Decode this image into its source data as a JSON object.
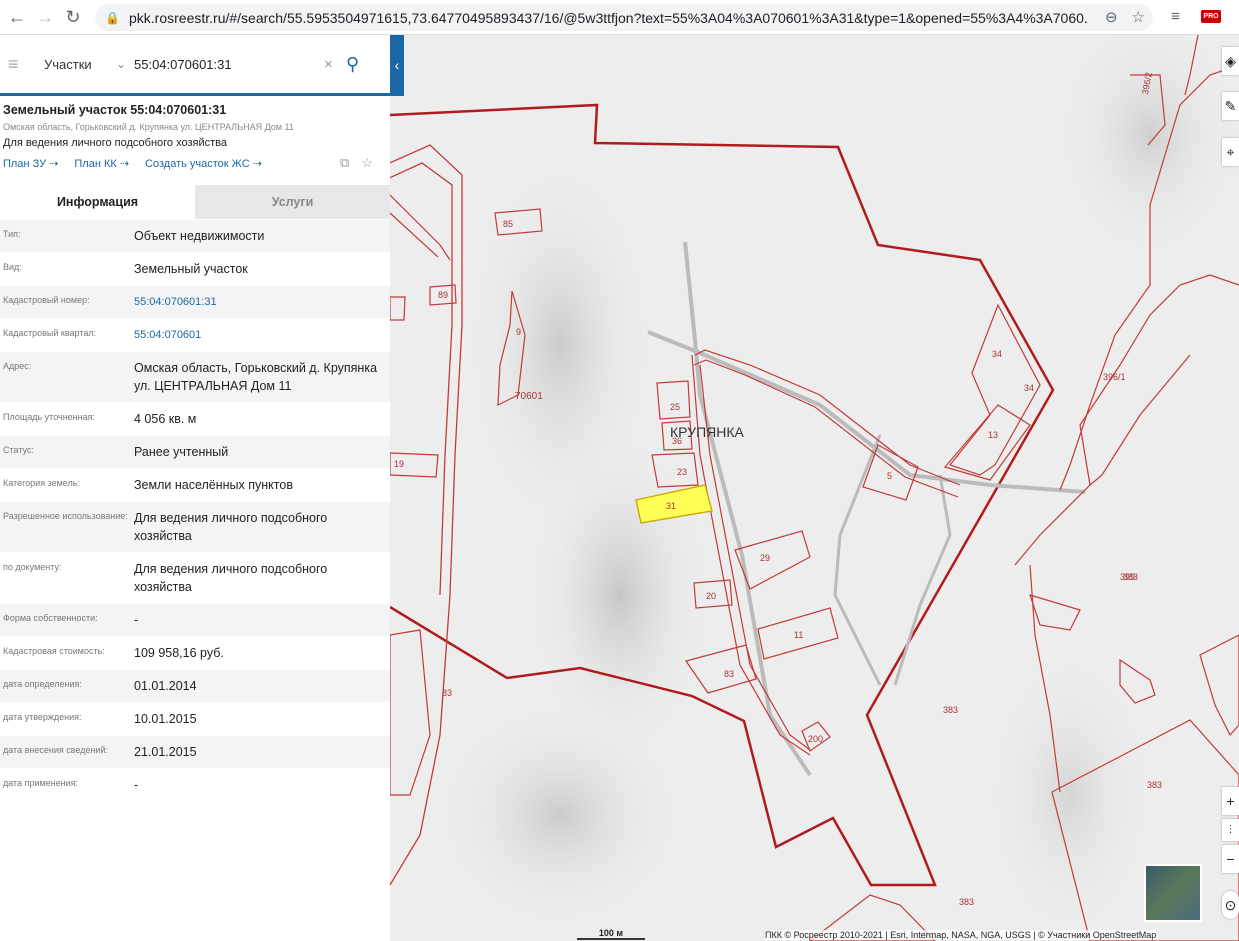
{
  "browser": {
    "url": "pkk.rosreestr.ru/#/search/55.5953504971615,73.64770495893437/16/@5w3ttfjon?text=55%3A04%3A070601%3A31&type=1&opened=55%3A4%3A7060...",
    "extension_badge": "PRO"
  },
  "search": {
    "type_label": "Участки",
    "query": "55:04:070601:31"
  },
  "object": {
    "title": "Земельный участок 55:04:070601:31",
    "address_short": "Омская область, Горьковский д. Крупянка ул. ЦЕНТРАЛЬНАЯ Дом 11",
    "purpose": "Для ведения личного подсобного хозяйства",
    "links": [
      "План ЗУ",
      "План КК",
      "Создать участок ЖС"
    ]
  },
  "tabs": {
    "info": "Информация",
    "services": "Услуги"
  },
  "details": [
    {
      "label": "Тип:",
      "value": "Объект недвижимости"
    },
    {
      "label": "Вид:",
      "value": "Земельный участок"
    },
    {
      "label": "Кадастровый номер:",
      "value": "55:04:070601:31"
    },
    {
      "label": "Кадастровый квартал:",
      "value": "55:04:070601"
    },
    {
      "label": "Адрес:",
      "value": "Омская область, Горьковский д. Крупянка ул. ЦЕНТРАЛЬНАЯ Дом 11"
    },
    {
      "label": "Площадь уточненная:",
      "value": "4 056 кв. м"
    },
    {
      "label": "Статус:",
      "value": "Ранее учтенный"
    },
    {
      "label": "Категория земель:",
      "value": "Земли населённых пунктов"
    },
    {
      "label": "Разрешенное использование:",
      "value": "Для ведения личного подсобного хозяйства"
    },
    {
      "label": "по документу:",
      "value": "Для ведения личного подсобного хозяйства"
    },
    {
      "label": "Форма собственности:",
      "value": "-"
    },
    {
      "label": "Кадастровая стоимость:",
      "value": "109 958,16 руб."
    },
    {
      "label": "дата определения:",
      "value": "01.01.2014"
    },
    {
      "label": "дата утверждения:",
      "value": "10.01.2015"
    },
    {
      "label": "дата внесения сведений:",
      "value": "21.01.2015"
    },
    {
      "label": "дата применения:",
      "value": "-"
    }
  ],
  "map": {
    "village_label": "КРУПЯНКА",
    "quarter_label": "70601",
    "parcel_labels": [
      "85",
      "89",
      "9",
      "19",
      "25",
      "36",
      "23",
      "31",
      "29",
      "20",
      "11",
      "83",
      "200",
      "5",
      "34",
      "34",
      "13",
      "396/1",
      "396/2",
      "383",
      "383",
      "383",
      "383",
      "83",
      "399"
    ],
    "scale": "100 м",
    "attribution": "ПКК © Росреестр 2010-2021 | Esri, Intermap, NASA, NGA, USGS | © Участники OpenStreetMap",
    "colors": {
      "boundary": "#b01c1c",
      "parcel": "#c23a3a",
      "selected_fill": "#ffff55"
    }
  }
}
